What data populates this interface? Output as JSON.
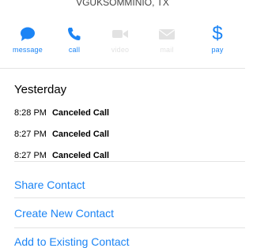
{
  "header": {
    "subtitle": "VGUKSOMMINIO, TX"
  },
  "actions": [
    {
      "label": "message",
      "icon": "message-bubble-icon",
      "enabled": true
    },
    {
      "label": "call",
      "icon": "phone-icon",
      "enabled": true
    },
    {
      "label": "video",
      "icon": "video-camera-icon",
      "enabled": false
    },
    {
      "label": "mail",
      "icon": "envelope-icon",
      "enabled": false
    },
    {
      "label": "pay",
      "icon": "dollar-icon",
      "enabled": true
    }
  ],
  "history": {
    "day": "Yesterday",
    "calls": [
      {
        "time": "8:28 PM",
        "status": "Canceled Call"
      },
      {
        "time": "8:27 PM",
        "status": "Canceled Call"
      },
      {
        "time": "8:27 PM",
        "status": "Canceled Call"
      }
    ]
  },
  "links": {
    "share": "Share Contact",
    "create": "Create New Contact",
    "add_existing": "Add to Existing Contact"
  },
  "colors": {
    "accent": "#1b84f5",
    "disabled": "#e2e2e2",
    "separator": "#e4e4e4"
  }
}
